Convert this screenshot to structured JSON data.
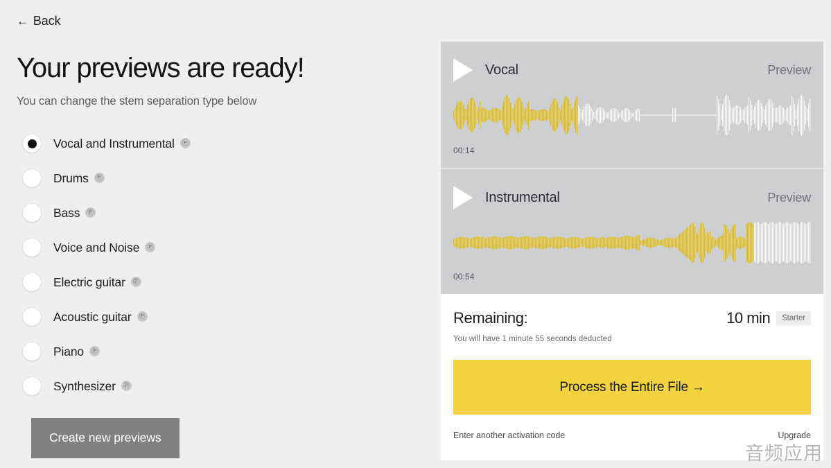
{
  "nav": {
    "back_label": "Back",
    "back_arrow": "←"
  },
  "header": {
    "title": "Your previews are ready!",
    "subtitle": "You can change the stem separation type below"
  },
  "stem_options": {
    "pro_badge": "Ⓟ",
    "items": [
      {
        "label": "Vocal and Instrumental",
        "pro": true,
        "selected": true
      },
      {
        "label": "Drums",
        "pro": true,
        "selected": false
      },
      {
        "label": "Bass",
        "pro": true,
        "selected": false
      },
      {
        "label": "Voice and Noise",
        "pro": true,
        "selected": false
      },
      {
        "label": "Electric guitar",
        "pro": true,
        "selected": false
      },
      {
        "label": "Acoustic guitar",
        "pro": true,
        "selected": false
      },
      {
        "label": "Piano",
        "pro": true,
        "selected": false
      },
      {
        "label": "Synthesizer",
        "pro": true,
        "selected": false
      }
    ]
  },
  "actions": {
    "create_previews_label": "Create new previews"
  },
  "previews": [
    {
      "name": "Vocal",
      "preview_label": "Preview",
      "time": "00:14",
      "played_fraction": 0.345
    },
    {
      "name": "Instrumental",
      "preview_label": "Preview",
      "time": "00:54",
      "played_fraction": 0.84
    }
  ],
  "summary": {
    "remaining_label": "Remaining:",
    "remaining_value": "10 min",
    "plan_badge": "Starter",
    "deduction_note": "You will have 1 minute 55 seconds deducted",
    "process_button": "Process the Entire File →",
    "activation_link": "Enter another activation code",
    "upgrade_link": "Upgrade"
  },
  "watermark": "音频应用",
  "colors": {
    "page_background": "#efefed",
    "card_gray": "#cdcfd1",
    "accent_yellow": "#f2d23f",
    "waveform_played": "#d4bb4e",
    "waveform_unplayed": "#f4f4f2",
    "create_button_gray": "#818181"
  }
}
